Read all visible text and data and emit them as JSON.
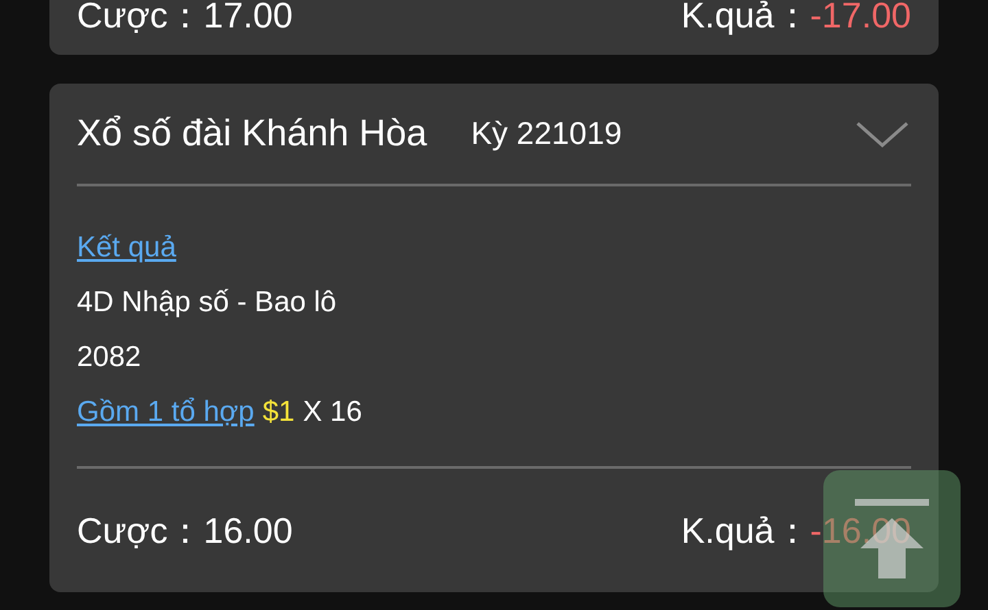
{
  "tickets": [
    {
      "footer": {
        "bet_label": "Cược：",
        "bet": "17.00",
        "result_label": "K.quả：",
        "result": "-17.00"
      }
    },
    {
      "title": "Xổ số đài Khánh Hòa",
      "period": "Kỳ 221019",
      "result_link": "Kết quả",
      "bet_type": "4D Nhập số - Bao lô",
      "numbers": "2082",
      "combo_link": "Gồm 1 tổ hợp",
      "unit": "$1",
      "multiplier": "X 16",
      "footer": {
        "bet_label": "Cược：",
        "bet": "16.00",
        "result_label": "K.quả：",
        "result": "-16.00"
      }
    }
  ]
}
